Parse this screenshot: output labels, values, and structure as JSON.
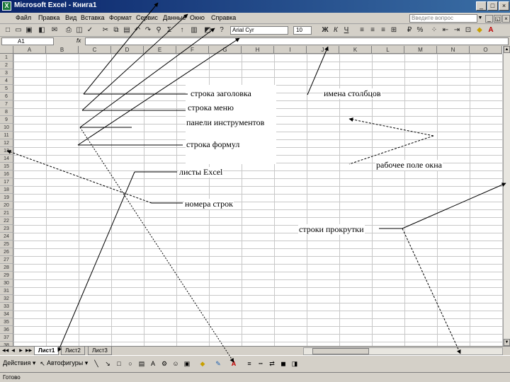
{
  "window": {
    "app_icon_letter": "X",
    "title": "Microsoft Excel - Книга1",
    "minimize_glyph": "_",
    "maximize_glyph": "□",
    "close_glyph": "×"
  },
  "menu": {
    "items": [
      "Файл",
      "Правка",
      "Вид",
      "Вставка",
      "Формат",
      "Сервис",
      "Данные",
      "Окно",
      "Справка"
    ],
    "help_placeholder": "Введите вопрос",
    "doc_minimize": "_",
    "doc_restore": "◱",
    "doc_close": "×"
  },
  "toolbar": {
    "font_name": "Arial Cyr",
    "font_size": "10",
    "icons": [
      "new-icon",
      "open-icon",
      "save-icon",
      "permission-icon",
      "email-icon",
      "print-icon",
      "print-preview-icon",
      "spelling-icon",
      "cut-icon",
      "copy-icon",
      "paste-icon",
      "format-painter-icon",
      "undo-icon",
      "redo-icon",
      "hyperlink-icon",
      "autosum-icon",
      "sort-asc-icon",
      "sort-desc-icon",
      "chart-wizard-icon",
      "drawing-icon",
      "zoom-icon",
      "help-icon"
    ],
    "format_icons": [
      "bold-icon",
      "italic-icon",
      "underline-icon",
      "align-left-icon",
      "align-center-icon",
      "align-right-icon",
      "merge-center-icon",
      "currency-icon",
      "percent-icon",
      "thousands-icon",
      "increase-decimal-icon",
      "decrease-decimal-icon",
      "decrease-indent-icon",
      "increase-indent-icon",
      "borders-icon",
      "fill-color-icon",
      "font-color-icon"
    ]
  },
  "formula_bar": {
    "name_box": "A1",
    "fx_label": "fx",
    "content": ""
  },
  "grid": {
    "columns": [
      "A",
      "B",
      "C",
      "D",
      "E",
      "F",
      "G",
      "H",
      "I",
      "J",
      "K",
      "L",
      "M",
      "N",
      "O"
    ],
    "rows": [
      "1",
      "2",
      "3",
      "4",
      "5",
      "6",
      "7",
      "8",
      "9",
      "10",
      "11",
      "12",
      "13",
      "14",
      "15",
      "16",
      "17",
      "18",
      "19",
      "20",
      "21",
      "22",
      "23",
      "24",
      "25",
      "26",
      "27",
      "28",
      "29",
      "30",
      "31",
      "32",
      "33",
      "34",
      "35",
      "36",
      "37",
      "38"
    ]
  },
  "sheets": {
    "tabs": [
      "Лист1",
      "Лист2",
      "Лист3"
    ],
    "active": "Лист1"
  },
  "drawing_toolbar": {
    "actions_label": "Действия ▾",
    "autoshapes_label": "Автофигуры ▾"
  },
  "status": {
    "text": "Готово"
  },
  "annotations": {
    "title_bar": "строка заголовка",
    "menu_bar": "строка меню",
    "toolbars": "панели инструментов",
    "formula_bar": "строка формул",
    "sheets": "листы Excel",
    "row_numbers": "номера строк",
    "column_names": "имена столбцов",
    "work_area": "рабочее поле окна",
    "scrollbars": "строки прокрутки"
  },
  "colors": {
    "title_bar_start": "#0a246a",
    "title_bar_end": "#3a6ea5",
    "chrome": "#d4d0c8",
    "gridline": "#c8c8c8"
  }
}
